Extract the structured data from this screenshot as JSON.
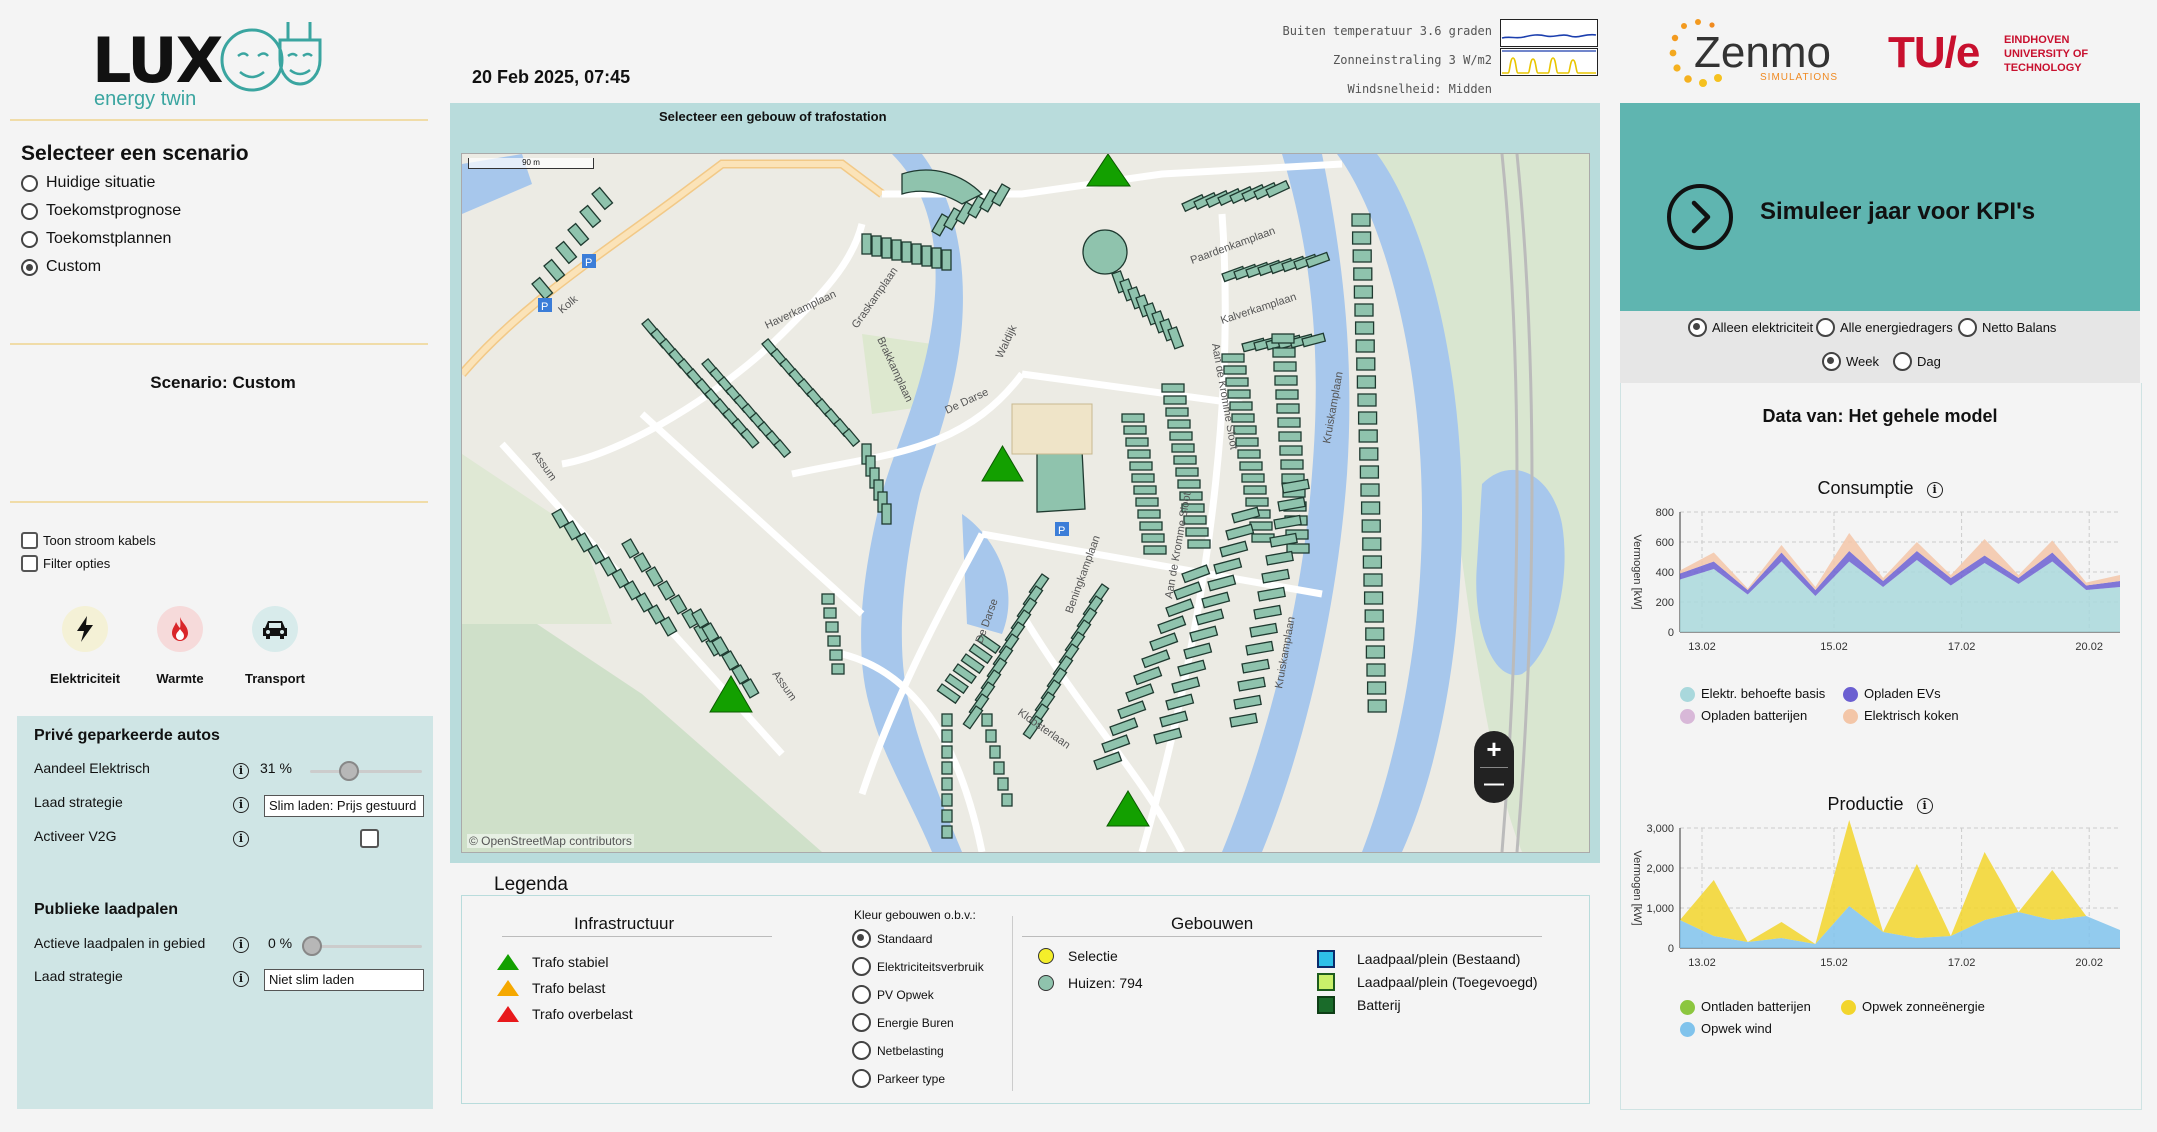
{
  "brand": {
    "lux_text": "LUX",
    "lux_sub": "energy twin",
    "zenmo_text": "Zenmo",
    "zenmo_sub": "SIMULATIONS",
    "tue_text": "TU/e",
    "tue_sub1": "EINDHOVEN",
    "tue_sub2": "UNIVERSITY OF",
    "tue_sub3": "TECHNOLOGY"
  },
  "header": {
    "datetime": "20 Feb 2025, 07:45",
    "weather": [
      {
        "label": "Buiten temperatuur 3.6 graden"
      },
      {
        "label": "Zonneinstraling 3 W/m2"
      },
      {
        "label": "Windsnelheid: Midden"
      }
    ]
  },
  "scenario": {
    "title": "Selecteer een scenario",
    "options": [
      "Huidige situatie",
      "Toekomstprognose",
      "Toekomstplannen",
      "Custom"
    ],
    "selected": "Custom",
    "current_label": "Scenario: Custom"
  },
  "toggles": {
    "cables": "Toon stroom kabels",
    "filter": "Filter opties"
  },
  "categories": [
    {
      "label": "Elektriciteit",
      "icon": "lightning-icon",
      "color": "#f4f1d6"
    },
    {
      "label": "Warmte",
      "icon": "flame-icon",
      "color": "#f6dada"
    },
    {
      "label": "Transport",
      "icon": "car-icon",
      "color": "#d8ebeb"
    }
  ],
  "settings": {
    "private_title": "Privé geparkeerde autos",
    "share_label": "Aandeel Elektrisch",
    "share_value": "31 %",
    "share_fraction": 0.31,
    "charge_label": "Laad strategie",
    "charge_value": "Slim laden: Prijs gestuurd",
    "v2g_label": "Activeer V2G",
    "public_title": "Publieke laadpalen",
    "active_label": "Actieve laadpalen in gebied",
    "active_value": "0 %",
    "active_fraction": 0,
    "public_charge_label": "Laad strategie",
    "public_charge_value": "Niet slim laden"
  },
  "map": {
    "title": "Selecteer een gebouw of trafostation",
    "scale": "90 m",
    "attribution": "© OpenStreetMap contributors",
    "zoom_in": "+",
    "zoom_out": "—",
    "streets": [
      "Haverkamplaan",
      "Graskamplaan",
      "Brakkamplaan",
      "Waldijk",
      "De Darse",
      "Paardenkamplaan",
      "Kalverkamplaan",
      "Aan de Kromme Sloot",
      "Kruiskamplaan",
      "Assum",
      "Beningkamplaan",
      "Kloosterlaan",
      "Kolk"
    ]
  },
  "legend": {
    "title": "Legenda",
    "infra_title": "Infrastructuur",
    "infra_items": [
      {
        "label": "Trafo stabiel",
        "color": "#13a000"
      },
      {
        "label": "Trafo belast",
        "color": "#f5a800"
      },
      {
        "label": "Trafo overbelast",
        "color": "#e8191b"
      }
    ],
    "color_title": "Kleur gebouwen o.b.v.:",
    "color_options": [
      "Standaard",
      "Elektriciteitsverbruik",
      "PV Opwek",
      "Energie Buren",
      "Netbelasting",
      "Parkeer type"
    ],
    "color_selected": "Standaard",
    "buildings_title": "Gebouwen",
    "selection_label": "Selectie",
    "houses_label": "Huizen: 794",
    "charge_items": [
      {
        "label": "Laadpaal/plein (Bestaand)",
        "fill": "#2ec0e8",
        "border": "#0b2a6a"
      },
      {
        "label": "Laadpaal/plein (Toegevoegd)",
        "fill": "#c9f06a",
        "border": "#1d5c1d"
      },
      {
        "label": "Batterij",
        "fill": "#1a6b2a",
        "border": "#0e3e16"
      }
    ]
  },
  "sim": {
    "button_label": "Simuleer jaar voor KPI's",
    "filter_options": [
      "Alleen elektriciteit",
      "Alle energiedragers",
      "Netto Balans"
    ],
    "filter_selected": "Alleen elektriciteit",
    "period_options": [
      "Week",
      "Dag"
    ],
    "period_selected": "Week",
    "data_title": "Data van: Het gehele model"
  },
  "chart_data": [
    {
      "type": "area",
      "title": "Consumptie",
      "ylabel": "Vermogen [kW]",
      "ylim": [
        0,
        800
      ],
      "yticks": [
        0,
        200,
        400,
        600,
        800
      ],
      "xticks": [
        "13.02",
        "15.02",
        "17.02",
        "20.02"
      ],
      "grid": true,
      "legend": "bottom",
      "x": [
        "13.02",
        "",
        "",
        "",
        "15.02",
        "",
        "",
        "",
        "17.02",
        "",
        "",
        "",
        "",
        "20.02"
      ],
      "series": [
        {
          "name": "Elektr. behoefte basis",
          "color": "#a9d8dc",
          "values": [
            350,
            420,
            250,
            470,
            240,
            470,
            300,
            480,
            310,
            460,
            320,
            470,
            280,
            300
          ]
        },
        {
          "name": "Opladen EVs",
          "color": "#6b5fd1",
          "values": [
            40,
            50,
            30,
            60,
            40,
            70,
            40,
            60,
            50,
            50,
            40,
            60,
            30,
            40
          ]
        },
        {
          "name": "Opladen batterijen",
          "color": "#d8b8d8",
          "values": [
            0,
            0,
            0,
            0,
            0,
            0,
            0,
            0,
            0,
            0,
            0,
            0,
            0,
            0
          ]
        },
        {
          "name": "Elektrisch koken",
          "color": "#f3c6a8",
          "values": [
            20,
            60,
            10,
            50,
            20,
            120,
            20,
            60,
            20,
            110,
            20,
            80,
            20,
            40
          ]
        }
      ]
    },
    {
      "type": "area",
      "title": "Productie",
      "ylabel": "Vermogen [kW]",
      "ylim": [
        0,
        3000
      ],
      "yticks": [
        "0",
        "1,000",
        "2,000",
        "3,000"
      ],
      "xticks": [
        "13.02",
        "15.02",
        "17.02",
        "20.02"
      ],
      "grid": true,
      "legend": "bottom",
      "series": [
        {
          "name": "Ontladen batterijen",
          "color": "#8cc63f",
          "values": [
            0,
            0,
            0,
            0,
            0,
            0,
            0,
            0,
            0,
            0,
            0,
            0,
            0,
            0
          ]
        },
        {
          "name": "Opwek zonneënergie",
          "color": "#f2d52c",
          "values": [
            0,
            1400,
            0,
            400,
            0,
            2150,
            0,
            1850,
            0,
            1700,
            0,
            1250,
            0,
            0
          ]
        },
        {
          "name": "Opwek wind",
          "color": "#80c3ec",
          "values": [
            700,
            300,
            150,
            250,
            100,
            1050,
            400,
            250,
            300,
            700,
            900,
            700,
            800,
            450
          ]
        }
      ]
    }
  ]
}
